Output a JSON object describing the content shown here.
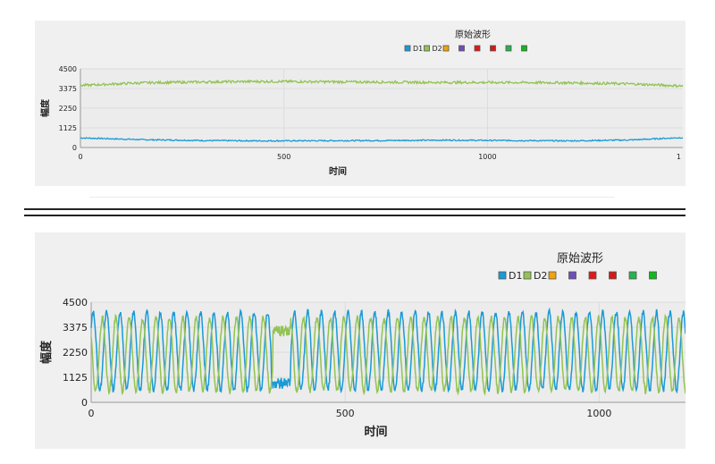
{
  "chart_data": [
    {
      "type": "line",
      "title": "原始波形",
      "xlabel": "时间",
      "ylabel": "幅度",
      "xlim": [
        0,
        1480
      ],
      "ylim": [
        0,
        4500
      ],
      "xticks": [
        0,
        500,
        1000,
        1
      ],
      "yticks": [
        0,
        1125,
        2250,
        3375,
        4500
      ],
      "grid": true,
      "legend_position": "top-right",
      "legend": [
        {
          "name": "D1",
          "color": "#1a9ad6"
        },
        {
          "name": "D2",
          "color": "#92c353"
        },
        {
          "name": "",
          "color": "#f0a30a"
        },
        {
          "name": "",
          "color": "#6d4fb8"
        },
        {
          "name": "",
          "color": "#e01818"
        },
        {
          "name": "",
          "color": "#d21a1a"
        },
        {
          "name": "",
          "color": "#25b34b"
        },
        {
          "name": "",
          "color": "#13b81c"
        }
      ],
      "series": [
        {
          "name": "D1",
          "color": "#1a9ad6",
          "kind": "baseline",
          "x": [
            0,
            150,
            300,
            450,
            600,
            750,
            900,
            1050,
            1200,
            1350,
            1480
          ],
          "values": [
            550,
            450,
            400,
            380,
            390,
            400,
            420,
            400,
            380,
            430,
            570
          ],
          "noise": 35
        },
        {
          "name": "D2",
          "color": "#92c353",
          "kind": "baseline",
          "x": [
            0,
            150,
            300,
            450,
            600,
            750,
            900,
            1050,
            1200,
            1350,
            1480
          ],
          "values": [
            3550,
            3700,
            3750,
            3780,
            3760,
            3740,
            3720,
            3720,
            3700,
            3640,
            3520
          ],
          "noise": 70
        }
      ]
    },
    {
      "type": "line",
      "title": "原始波形",
      "xlabel": "时间",
      "ylabel": "幅度",
      "xlim": [
        0,
        1170
      ],
      "ylim": [
        0,
        4500
      ],
      "xticks": [
        0,
        500,
        1000
      ],
      "yticks": [
        0,
        1125,
        2250,
        3375,
        4500
      ],
      "grid": true,
      "legend_position": "top-right",
      "legend": [
        {
          "name": "D1",
          "color": "#1a9ad6"
        },
        {
          "name": "D2",
          "color": "#92c353"
        },
        {
          "name": "",
          "color": "#f0a30a"
        },
        {
          "name": "",
          "color": "#6d4fb8"
        },
        {
          "name": "",
          "color": "#e01818"
        },
        {
          "name": "",
          "color": "#d21a1a"
        },
        {
          "name": "",
          "color": "#25b34b"
        },
        {
          "name": "",
          "color": "#13b81c"
        }
      ],
      "series": [
        {
          "name": "D1",
          "color": "#1a9ad6",
          "kind": "sine",
          "mean": 2300,
          "amplitude": 1750,
          "period": 26.4,
          "phase": 0.6,
          "dropout": [
            {
              "start": 355,
              "end": 392,
              "level": 850
            }
          ]
        },
        {
          "name": "D2",
          "color": "#92c353",
          "kind": "sine",
          "mean": 2150,
          "amplitude": 1650,
          "period": 26.4,
          "phase": 2.6,
          "dropout": [
            {
              "start": 358,
              "end": 392,
              "level": 3200
            }
          ]
        }
      ]
    }
  ]
}
